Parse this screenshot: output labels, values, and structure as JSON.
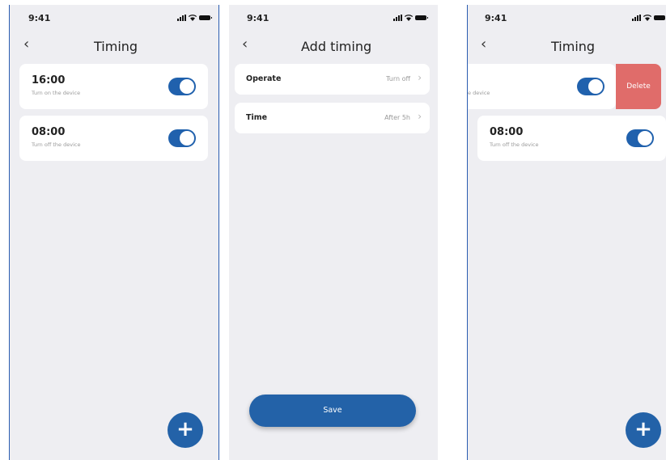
{
  "status": {
    "time": "9:41"
  },
  "screens": {
    "timing_list": {
      "title": "Timing",
      "items": [
        {
          "time": "16:00",
          "description": "Turn on the device",
          "enabled": true
        },
        {
          "time": "08:00",
          "description": "Turn off the device",
          "enabled": true
        }
      ],
      "fab_symbol": "+"
    },
    "add_timing": {
      "title": "Add timing",
      "rows": [
        {
          "label": "Operate",
          "value": "Turn off"
        },
        {
          "label": "Time",
          "value": "After 5h"
        }
      ],
      "save_label": "Save"
    },
    "timing_swipe": {
      "title": "Timing",
      "swiped_item": {
        "description_fragment": "e device",
        "enabled": true
      },
      "delete_label": "Delete",
      "items": [
        {
          "time": "08:00",
          "description": "Turn off the device",
          "enabled": true
        }
      ],
      "fab_symbol": "+"
    }
  },
  "colors": {
    "accent": "#2362a8",
    "delete": "#e06c6a",
    "background": "#eeeef2"
  },
  "icons": {
    "back": "chevron-left-icon",
    "add": "plus-icon",
    "forward": "chevron-right-icon"
  }
}
